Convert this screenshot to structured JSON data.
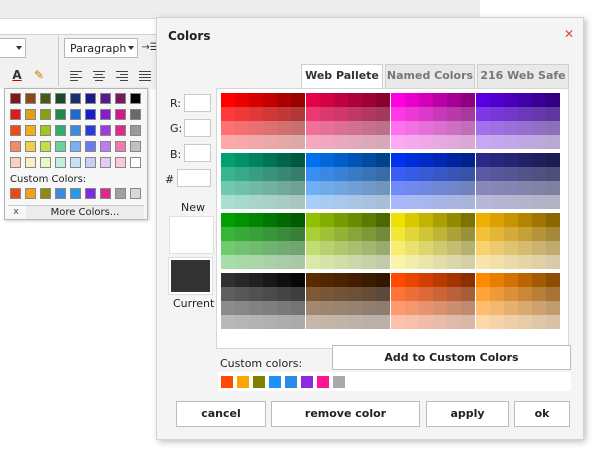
{
  "editor": {
    "paragraph_select": "Paragraph",
    "font_color_glyph": "A",
    "indent_glyph": "→☰",
    "highlight_glyph": "✎"
  },
  "picker": {
    "rows": [
      [
        "#7f1a1a",
        "#8a4a14",
        "#4a5a12",
        "#1e4a2c",
        "#16306e",
        "#1a1a8a",
        "#5a1a8a",
        "#7a1a5a",
        "#000000"
      ],
      [
        "#e01a1a",
        "#e0a014",
        "#8aa014",
        "#1e8a4a",
        "#1a6ad0",
        "#1a1ad0",
        "#8a1ad0",
        "#d01a8a",
        "#6a6a6a"
      ],
      [
        "#f04a1a",
        "#f0b01a",
        "#a0c81a",
        "#2ab06a",
        "#3a8ae0",
        "#2a3ae0",
        "#a03ae0",
        "#e02a8a",
        "#9a9a9a"
      ],
      [
        "#f08a6a",
        "#f0d04a",
        "#c0e04a",
        "#6ad0a0",
        "#7ab0f0",
        "#6a7af0",
        "#c07af0",
        "#f07ab0",
        "#c0c0c0"
      ],
      [
        "#f8d0c0",
        "#f8f0c0",
        "#e8f8c0",
        "#c0f0e0",
        "#c8e0f8",
        "#c8d0f8",
        "#e8c8f8",
        "#f8c8e0",
        "#ffffff"
      ]
    ],
    "custom_label": "Custom Colors:",
    "custom": [
      "#e84a14",
      "#f0a01a",
      "#8a8a14",
      "#3a8ae0",
      "#2a9ae8",
      "#7a2ae0",
      "#e02a8a",
      "#a0a0a0",
      "#d8d8d8"
    ],
    "clear_glyph": "x",
    "more_label": "More Colors..."
  },
  "dialog": {
    "title": "Colors",
    "close_glyph": "✕",
    "tabs": [
      {
        "label": "Web Pallete",
        "active": true
      },
      {
        "label": "Named Colors",
        "active": false
      },
      {
        "label": "216 Web Safe",
        "active": false
      }
    ],
    "r_label": "R:",
    "g_label": "G:",
    "b_label": "B:",
    "hex_label": "#",
    "new_label": "New",
    "current_label": "Current",
    "new_color": "#ffffff",
    "current_color": "#333333",
    "custom_colors_label": "Custom colors:",
    "add_label": "Add to Custom Colors",
    "custom_colors": [
      "#ff4a00",
      "#ffa500",
      "#808000",
      "#1e90ff",
      "#2a8ae8",
      "#8a2be2",
      "#ff1493",
      "#a9a9a9"
    ],
    "buttons": {
      "cancel": "cancel",
      "remove": "remove color",
      "apply": "apply",
      "ok": "ok"
    }
  },
  "palette": {
    "hues": [
      [
        "#ff0000",
        "#e5004a",
        "#ff00e0",
        "#5a00e0"
      ],
      [
        "#00a070",
        "#0070f0",
        "#0030f0",
        "#2a2a8a"
      ],
      [
        "#00a000",
        "#90c000",
        "#f0e000",
        "#f0b000"
      ],
      [
        "#303030",
        "#5a2a00",
        "#ff4a00",
        "#ff8a00"
      ]
    ],
    "darks": [
      [
        "#8a0000",
        "#7a002a",
        "#7a0070",
        "#2a0070"
      ],
      [
        "#004a3a",
        "#003a7a",
        "#00207a",
        "#1a1a4a"
      ],
      [
        "#005000",
        "#405a00",
        "#6a6000",
        "#7a5a00"
      ],
      [
        "#000000",
        "#2a1400",
        "#7a2a00",
        "#7a4200"
      ]
    ]
  }
}
